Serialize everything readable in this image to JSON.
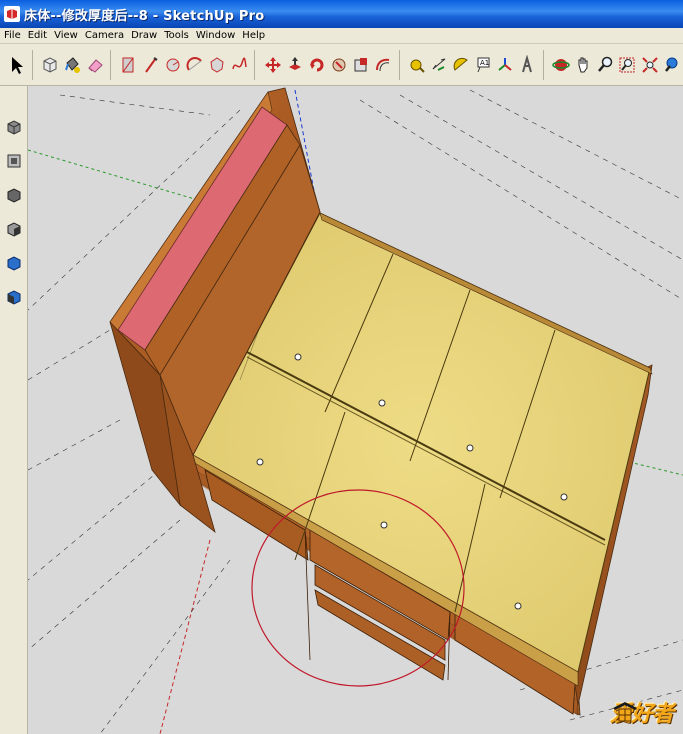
{
  "window": {
    "title": "床体--修改厚度后--8 - SketchUp Pro"
  },
  "menu": [
    "File",
    "Edit",
    "View",
    "Camera",
    "Draw",
    "Tools",
    "Window",
    "Help"
  ],
  "toolbar": {
    "tools": [
      {
        "icon": "select-arrow-icon"
      },
      {
        "icon": "make-component-icon"
      },
      {
        "icon": "paint-bucket-icon"
      },
      {
        "icon": "eraser-icon"
      },
      {
        "icon": "rectangle-icon"
      },
      {
        "icon": "line-pencil-icon"
      },
      {
        "icon": "circle-icon"
      },
      {
        "icon": "arc-icon"
      },
      {
        "icon": "polygon-icon"
      },
      {
        "icon": "freehand-icon"
      },
      {
        "icon": "move-icon"
      },
      {
        "icon": "push-pull-icon"
      },
      {
        "icon": "rotate-icon"
      },
      {
        "icon": "follow-me-icon"
      },
      {
        "icon": "scale-icon"
      },
      {
        "icon": "offset-icon"
      },
      {
        "icon": "tape-measure-icon"
      },
      {
        "icon": "dimension-icon"
      },
      {
        "icon": "protractor-icon"
      },
      {
        "icon": "text-icon"
      },
      {
        "icon": "axes-icon"
      },
      {
        "icon": "3d-text-icon"
      },
      {
        "icon": "orbit-icon"
      },
      {
        "icon": "pan-hand-icon"
      },
      {
        "icon": "zoom-icon"
      },
      {
        "icon": "zoom-window-icon"
      },
      {
        "icon": "zoom-extents-icon"
      },
      {
        "icon": "previous-view-icon"
      }
    ]
  },
  "sidebar": {
    "views": [
      {
        "icon": "iso-view-icon"
      },
      {
        "icon": "top-view-icon"
      },
      {
        "icon": "front-view-icon"
      },
      {
        "icon": "right-view-icon"
      },
      {
        "icon": "back-view-icon"
      },
      {
        "icon": "left-view-icon"
      }
    ]
  },
  "watermark": {
    "text": "爱好者"
  },
  "colors": {
    "wood": "#b5652a",
    "wood_dark": "#8b4a18",
    "panel": "#e6d27a",
    "headboard_top": "#d9646e",
    "selection_circle": "#c0182a"
  }
}
